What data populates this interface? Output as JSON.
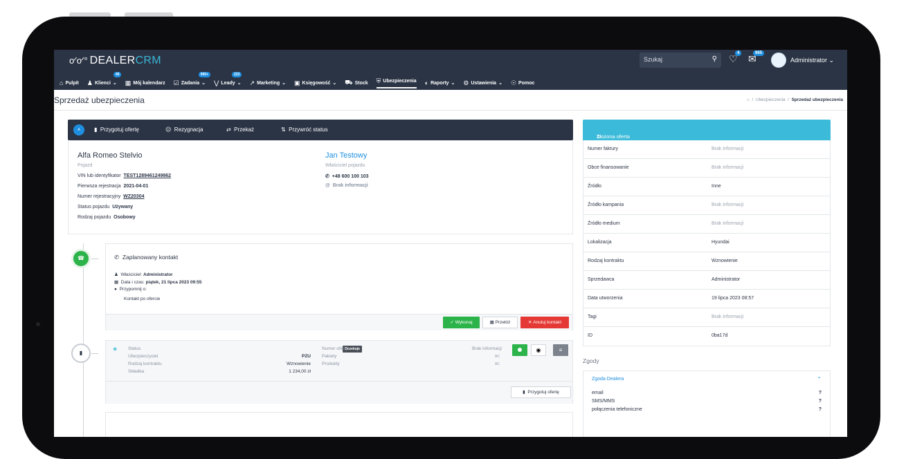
{
  "header": {
    "logo_main": "DEALER",
    "logo_accent": "CRM",
    "search_placeholder": "Szukaj",
    "notif_count": "4",
    "mail_count": "965",
    "user": "Administrator"
  },
  "nav": [
    {
      "label": "Pulpit",
      "icon": "home-icon"
    },
    {
      "label": "Klienci",
      "icon": "users-icon",
      "badge": "49"
    },
    {
      "label": "Mój kalendarz",
      "icon": "calendar-icon"
    },
    {
      "label": "Zadania",
      "icon": "check-icon",
      "badge": "999+"
    },
    {
      "label": "Leady",
      "icon": "funnel-icon",
      "badge": "222"
    },
    {
      "label": "Marketing",
      "icon": "chart-icon"
    },
    {
      "label": "Księgowość",
      "icon": "wallet-icon"
    },
    {
      "label": "Stock",
      "icon": "car-icon"
    },
    {
      "label": "Ubezpieczenia",
      "icon": "shield-icon"
    },
    {
      "label": "Raporty",
      "icon": "pie-icon"
    },
    {
      "label": "Ustawienia",
      "icon": "gear-icon"
    },
    {
      "label": "Pomoc",
      "icon": "lifebuoy-icon"
    }
  ],
  "page": {
    "title": "Sprzedaż ubezpieczenia",
    "breadcrumb_1": "Ubezpieczenia",
    "breadcrumb_2": "Sprzedaż ubezpieczenia",
    "crumb_sep": "/"
  },
  "actions": {
    "avatar": "A",
    "prepare_offer": "Przygotuj ofertę",
    "resignation": "Rezygnacja",
    "transfer": "Przekaż",
    "restore_status": "Przywróć status"
  },
  "vehicle": {
    "name": "Alfa Romeo Stelvio",
    "subtitle": "Pojazd",
    "vin_label": "VIN lub identyfikator",
    "vin": "TEST1289461249862",
    "first_reg_label": "Pierwsza rejestracja",
    "first_reg": "2021-04-01",
    "reg_no_label": "Numer rejestracyjny",
    "reg_no": "WZ20304",
    "status_label": "Status pojazdu",
    "status": "Używany",
    "type_label": "Rodzaj pojazdu",
    "type": "Osobowy"
  },
  "owner": {
    "name": "Jan Testowy",
    "subtitle": "Właściciel pojazdu",
    "phone": "+48 600 100 103",
    "email": "Brak informacji"
  },
  "contact": {
    "title": "Zaplanowany kontakt",
    "owner_label": "Właściciel:",
    "owner": "Administrator",
    "datetime_label": "Data i czas:",
    "datetime": "piątek, 21 lipca 2023 09:55",
    "remind_label": "Przypomnij o:",
    "remind_text": "Kontakt po ofercie",
    "btn_do": "Wykonaj",
    "btn_move": "Przełóż",
    "btn_cancel": "Anuluj kontakt"
  },
  "insurance": {
    "status_label": "Status",
    "status": "Oczekuje",
    "insurer_label": "Ubezpieczyciel",
    "insurer": "PZU",
    "contract_label": "Rodzaj kontraktu",
    "contract": "Wznowienie",
    "premium_label": "Składka",
    "premium": "1 234,00 zł",
    "offer_no_label": "Numer oferty",
    "offer_no": "Brak informacji",
    "packages_label": "Pakiety",
    "packages": "AC",
    "products_label": "Produkty",
    "products": "AC",
    "prepare_btn": "Przygotuj ofertę"
  },
  "offer": {
    "header": "Złożona oferta",
    "rows": [
      {
        "k": "Numer faktury",
        "v": "Brak informacji",
        "muted": true
      },
      {
        "k": "Obce finansowanie",
        "v": "Brak informacji",
        "muted": true
      },
      {
        "k": "Źródło",
        "v": "Inne",
        "muted": false
      },
      {
        "k": "Źródło kampania",
        "v": "Brak informacji",
        "muted": true
      },
      {
        "k": "Źródło medium",
        "v": "Brak informacji",
        "muted": true
      },
      {
        "k": "Lokalizacja",
        "v": "Hyundai",
        "muted": false
      },
      {
        "k": "Rodzaj kontraktu",
        "v": "Wznowienie",
        "muted": false
      },
      {
        "k": "Sprzedawca",
        "v": "Administrator",
        "muted": false
      },
      {
        "k": "Data utworzenia",
        "v": "19 lipca 2023 08:57",
        "muted": false
      },
      {
        "k": "Tagi",
        "v": "Brak informacji",
        "muted": true
      },
      {
        "k": "ID",
        "v": "0ba17d",
        "muted": false
      }
    ]
  },
  "consents": {
    "section": "Zgody",
    "group": "Zgoda Dealera",
    "items": [
      "email",
      "SMS/MMS",
      "połączenia telefoniczne"
    ],
    "value": "?"
  },
  "colors": {
    "nav_bg": "#2b3445",
    "accent_blue": "#1e8fe0",
    "accent_cyan": "#3bbbd9",
    "green": "#2cb34a",
    "red": "#e53935"
  }
}
